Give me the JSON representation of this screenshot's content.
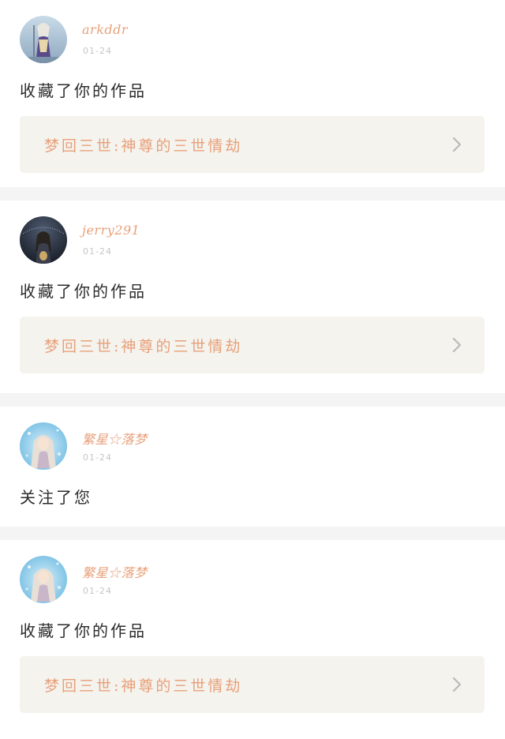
{
  "feed": [
    {
      "username": "arkddr",
      "date": "01-24",
      "action": "收藏了你的作品",
      "work_title": "梦回三世:神尊的三世情劫",
      "avatar_icon": "avatar-fantasy-warrior",
      "has_work": true
    },
    {
      "username": "jerry291",
      "date": "01-24",
      "action": "收藏了你的作品",
      "work_title": "梦回三世:神尊的三世情劫",
      "avatar_icon": "avatar-night-girl",
      "has_work": true
    },
    {
      "username": "繁星☆落梦",
      "date": "01-24",
      "action": "关注了您",
      "avatar_icon": "avatar-anime-girl",
      "has_work": false
    },
    {
      "username": "繁星☆落梦",
      "date": "01-24",
      "action": "收藏了你的作品",
      "work_title": "梦回三世:神尊的三世情劫",
      "avatar_icon": "avatar-anime-girl",
      "has_work": true
    }
  ],
  "colors": {
    "accent": "#e8a07a",
    "text": "#2b2b2b",
    "date": "#c6c6c6",
    "link_bg": "#f4f3ee",
    "separator": "#f4f4f4"
  },
  "icons": {
    "chevron": "chevron-right-icon"
  }
}
